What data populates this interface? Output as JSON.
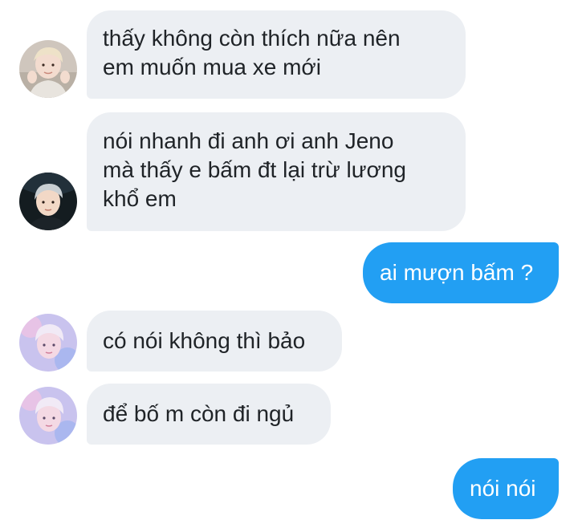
{
  "messages": [
    {
      "sender": "left",
      "avatar": "avatar-blond-boy-icon",
      "text": "thấy không còn thích nữa nên\nem muốn mua xe mới"
    },
    {
      "sender": "left",
      "avatar": "avatar-dark-boy-icon",
      "text": "nói nhanh đi anh ơi anh Jeno\nmà thấy e bấm đt lại trừ lương\nkhổ em"
    },
    {
      "sender": "right",
      "text": "ai mượn bấm ?"
    },
    {
      "sender": "left",
      "avatar": "avatar-pastel-boy-icon",
      "text": "có nói không thì bảo"
    },
    {
      "sender": "left",
      "avatar": "avatar-pastel-boy-icon",
      "text": "để bố m còn đi ngủ"
    },
    {
      "sender": "right",
      "text": "nói nói"
    }
  ],
  "colors": {
    "incoming_bubble": "#eceff3",
    "incoming_text": "#1f2327",
    "outgoing_bubble": "#229ff3",
    "outgoing_text": "#ffffff",
    "background": "#ffffff"
  }
}
